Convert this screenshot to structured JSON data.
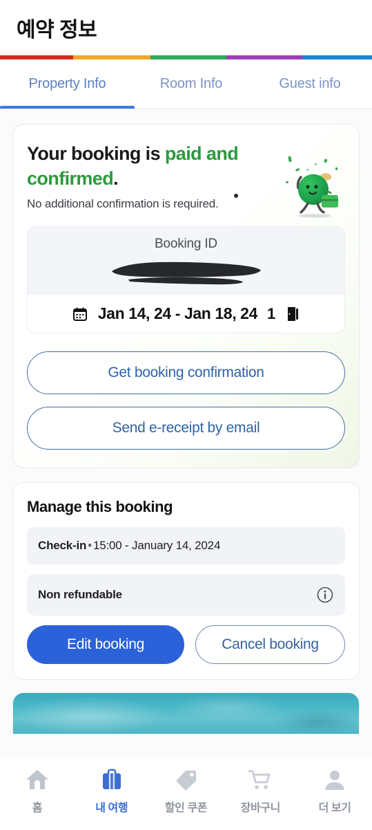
{
  "header": {
    "title": "예약 정보"
  },
  "rainbow": {
    "colors": [
      "#d52b1e",
      "#efa72c",
      "#2faa5c",
      "#9b3fb5",
      "#1a85d6"
    ]
  },
  "tabs": {
    "active_index": 0,
    "items": [
      {
        "label": "Property Info"
      },
      {
        "label": "Room Info"
      },
      {
        "label": "Guest info"
      }
    ],
    "underline_color": "#3f7ae0"
  },
  "confirmation": {
    "heading_plain_1": "Your booking is ",
    "heading_highlight_1": "paid and",
    "heading_highlight_2": "confirmed",
    "heading_plain_2": ".",
    "subtitle": "No additional confirmation is required.",
    "highlight_color": "#2c9a3c",
    "mascot_icon": "green-traveler-mascot-icon",
    "booking_id": {
      "label": "Booking ID",
      "value_redacted": true,
      "redaction_color": "#26282b",
      "calendar_icon": "calendar-icon",
      "dates": "Jan 14, 24 - Jan 18, 24",
      "rooms_count": "1",
      "door_icon": "door-icon"
    },
    "buttons": [
      {
        "label": "Get booking confirmation"
      },
      {
        "label": "Send e-receipt by email"
      }
    ]
  },
  "manage": {
    "title": "Manage this booking",
    "rows": [
      {
        "label": "Check-in",
        "separator": "•",
        "value": "15:00 - January 14, 2024",
        "has_info_icon": false
      },
      {
        "label": "Non refundable",
        "separator": "",
        "value": "",
        "has_info_icon": true,
        "info_icon": "info-circle-icon"
      }
    ],
    "primary_button": {
      "label": "Edit booking",
      "color": "#2b62d9"
    },
    "secondary_button": {
      "label": "Cancel booking",
      "color": "#35619e"
    }
  },
  "ocean_card": {
    "image_alt": "ocean-photo",
    "accent_color": "#46b6c6"
  },
  "bottom_nav": {
    "active_index": 1,
    "active_color": "#3b6fd4",
    "inactive_color": "#8f959e",
    "items": [
      {
        "label": "홈",
        "icon": "home-icon"
      },
      {
        "label": "내 여행",
        "icon": "suitcase-icon"
      },
      {
        "label": "할인 쿠폰",
        "icon": "tag-icon"
      },
      {
        "label": "장바구니",
        "icon": "cart-icon"
      },
      {
        "label": "더 보기",
        "icon": "person-icon"
      }
    ]
  }
}
